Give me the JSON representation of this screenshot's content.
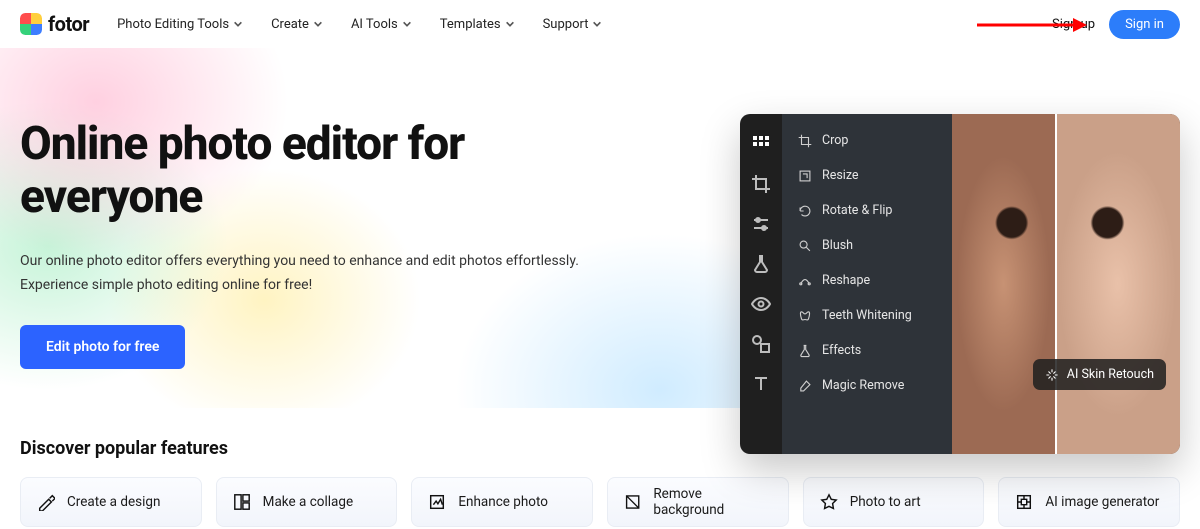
{
  "brand": {
    "name": "fotor"
  },
  "nav": {
    "items": [
      {
        "label": "Photo Editing Tools"
      },
      {
        "label": "Create"
      },
      {
        "label": "AI Tools"
      },
      {
        "label": "Templates"
      },
      {
        "label": "Support"
      }
    ]
  },
  "auth": {
    "signup": "Sign up",
    "signin": "Sign in"
  },
  "hero": {
    "title": "Online photo editor for everyone",
    "subtitle": "Our online photo editor offers everything you need to enhance and edit photos effortlessly. Experience simple photo editing online for free!",
    "cta": "Edit photo for free"
  },
  "editor": {
    "rail": [
      {
        "name": "grid-icon"
      },
      {
        "name": "crop-icon"
      },
      {
        "name": "sliders-icon"
      },
      {
        "name": "flask-icon"
      },
      {
        "name": "eye-icon"
      },
      {
        "name": "shapes-icon"
      },
      {
        "name": "text-icon"
      }
    ],
    "tools": [
      {
        "label": "Crop",
        "icon": "crop-icon"
      },
      {
        "label": "Resize",
        "icon": "resize-icon"
      },
      {
        "label": "Rotate & Flip",
        "icon": "rotate-icon"
      },
      {
        "label": "Blush",
        "icon": "blush-icon"
      },
      {
        "label": "Reshape",
        "icon": "reshape-icon"
      },
      {
        "label": "Teeth Whitening",
        "icon": "teeth-icon"
      },
      {
        "label": "Effects",
        "icon": "effects-icon"
      },
      {
        "label": "Magic Remove",
        "icon": "eraser-icon"
      }
    ],
    "ai_chip": "AI Skin Retouch"
  },
  "discover": {
    "title": "Discover popular features",
    "features": [
      {
        "label": "Create a design",
        "icon": "design-icon"
      },
      {
        "label": "Make a collage",
        "icon": "collage-icon"
      },
      {
        "label": "Enhance photo",
        "icon": "enhance-icon"
      },
      {
        "label": "Remove background",
        "icon": "remove-bg-icon"
      },
      {
        "label": "Photo to art",
        "icon": "photo-art-icon"
      },
      {
        "label": "AI image generator",
        "icon": "ai-gen-icon"
      }
    ]
  }
}
